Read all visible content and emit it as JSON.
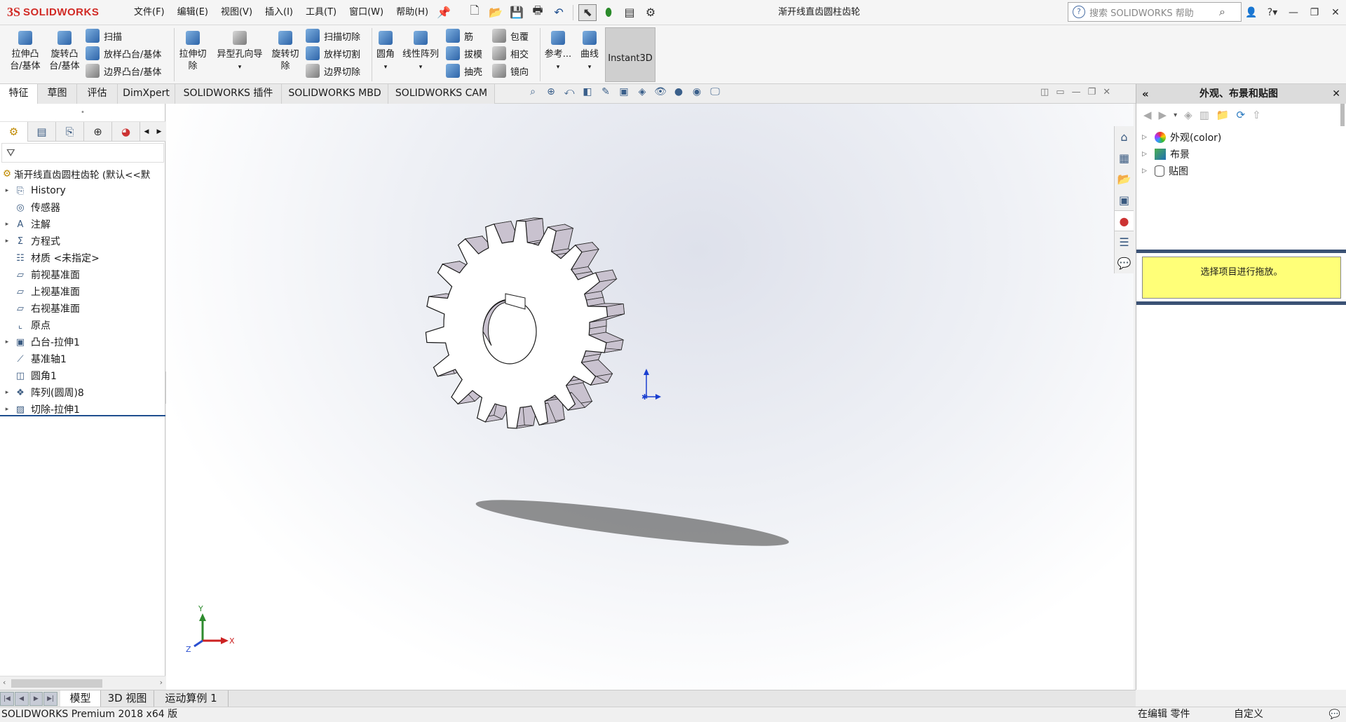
{
  "app": {
    "logo_mark": "3S",
    "logo_text": "SOLIDWORKS"
  },
  "menus": [
    "文件(F)",
    "编辑(E)",
    "视图(V)",
    "插入(I)",
    "工具(T)",
    "窗口(W)",
    "帮助(H)"
  ],
  "document_title": "渐开线直齿圆柱齿轮",
  "search": {
    "placeholder": "搜索 SOLIDWORKS 帮助",
    "help_glyph": "?"
  },
  "ribbon": {
    "extrude_boss": "拉伸凸台/基体",
    "revolve_boss": "旋转凸台/基体",
    "sweep": "扫描",
    "loft_boss": "放样凸台/基体",
    "boundary_boss": "边界凸台/基体",
    "extrude_cut": "拉伸切除",
    "hole_wizard": "异型孔向导",
    "revolve_cut": "旋转切除",
    "sweep_cut": "扫描切除",
    "loft_cut": "放样切割",
    "boundary_cut": "边界切除",
    "fillet": "圆角",
    "linear_pattern": "线性阵列",
    "rib": "筋",
    "draft": "拔模",
    "shell": "抽壳",
    "wrap": "包覆",
    "intersect": "相交",
    "mirror": "镜向",
    "reference": "参考...",
    "curves": "曲线",
    "instant3d": "Instant3D"
  },
  "tabs": [
    "特征",
    "草图",
    "评估",
    "DimXpert",
    "SOLIDWORKS 插件",
    "SOLIDWORKS MBD",
    "SOLIDWORKS CAM"
  ],
  "task_pane": {
    "title": "外观、布景和贴图",
    "items": [
      "外观(color)",
      "布景",
      "贴图"
    ],
    "hint": "选择项目进行拖放。"
  },
  "tree": {
    "root": "渐开线直齿圆柱齿轮 (默认<<默",
    "items": [
      {
        "label": "History",
        "icon": "history-icon",
        "expand": true
      },
      {
        "label": "传感器",
        "icon": "sensor-icon",
        "expand": false
      },
      {
        "label": "注解",
        "icon": "annotation-icon",
        "expand": true
      },
      {
        "label": "方程式",
        "icon": "equation-icon",
        "expand": true
      },
      {
        "label": "材质 <未指定>",
        "icon": "material-icon",
        "expand": false
      },
      {
        "label": "前视基准面",
        "icon": "plane-icon",
        "expand": false
      },
      {
        "label": "上视基准面",
        "icon": "plane-icon",
        "expand": false
      },
      {
        "label": "右视基准面",
        "icon": "plane-icon",
        "expand": false
      },
      {
        "label": "原点",
        "icon": "origin-icon",
        "expand": false
      },
      {
        "label": "凸台-拉伸1",
        "icon": "boss-extrude-icon",
        "expand": true
      },
      {
        "label": "基准轴1",
        "icon": "axis-icon",
        "expand": false
      },
      {
        "label": "圆角1",
        "icon": "fillet-icon",
        "expand": false
      },
      {
        "label": "阵列(圆周)8",
        "icon": "circular-pattern-icon",
        "expand": true
      },
      {
        "label": "切除-拉伸1",
        "icon": "cut-extrude-icon",
        "expand": true
      }
    ]
  },
  "triad": {
    "x": "X",
    "y": "Y",
    "z": "Z"
  },
  "bottom_tabs": [
    "模型",
    "3D 视图",
    "运动算例 1"
  ],
  "status": {
    "product": "SOLIDWORKS Premium 2018 x64 版",
    "editing": "在编辑 零件",
    "custom": "自定义"
  },
  "colors": {
    "logo_red": "#d12a25",
    "tree_line": "#1f4f8f",
    "hint_bg": "#ffff78",
    "gear_side": "#c9c2cf",
    "task_divider": "#3b5275"
  }
}
